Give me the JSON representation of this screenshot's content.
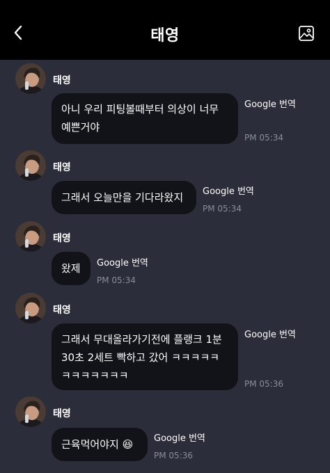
{
  "header": {
    "title": "태영",
    "back_icon": "chevron-left-icon",
    "photo_icon": "image-icon"
  },
  "messages": [
    {
      "sender": "태영",
      "lines": [
        "아니 우리 피팅볼때부터 의상이 너무",
        "예쁜거야"
      ],
      "translate_label": "Google 번역",
      "time": "PM 05:34"
    },
    {
      "sender": "태영",
      "lines": [
        "그래서 오늘만을 기다라왔지"
      ],
      "translate_label": "Google 번역",
      "time": "PM 05:34"
    },
    {
      "sender": "태영",
      "lines": [
        "왔제"
      ],
      "translate_label": "Google 번역",
      "time": "PM 05:34"
    },
    {
      "sender": "태영",
      "lines": [
        "그래서 무대올라가기전에 플랭크 1분",
        "30초 2세트 빡하고 갔어 ㅋㅋㅋㅋㅋ",
        "ㅋㅋㅋㅋㅋㅋㅋ"
      ],
      "translate_label": "Google 번역",
      "time": "PM 05:36"
    },
    {
      "sender": "태영",
      "lines": [
        "근육먹어야지 😆"
      ],
      "translate_label": "Google 번역",
      "time": "PM 05:36"
    }
  ]
}
